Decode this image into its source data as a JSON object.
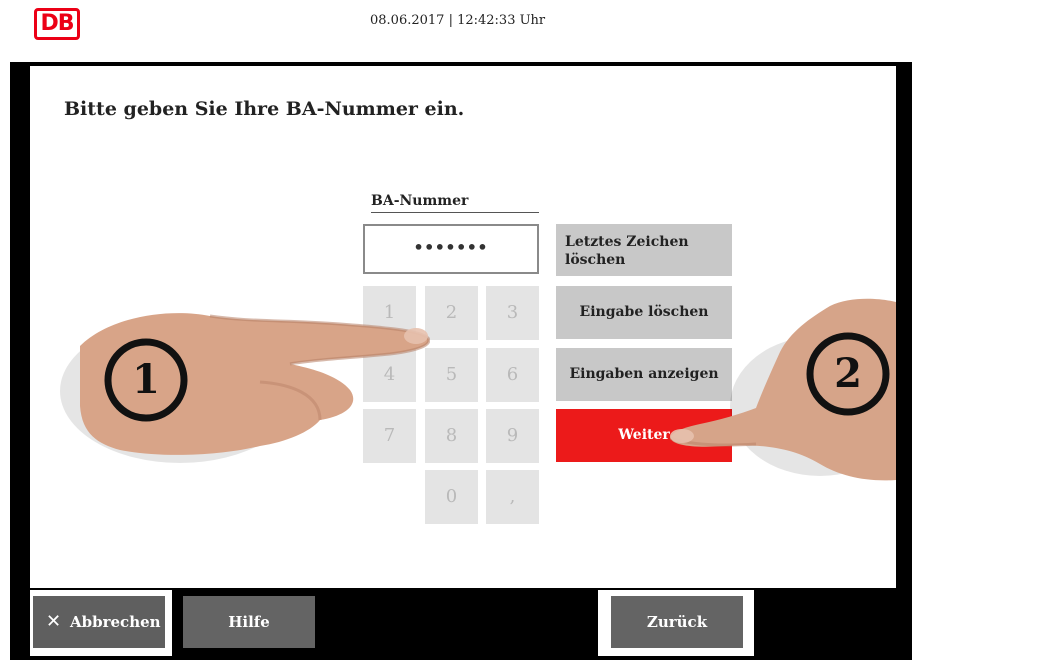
{
  "header": {
    "logo_text": "DB",
    "datetime": "08.06.2017 | 12:42:33 Uhr"
  },
  "main": {
    "prompt": "Bitte geben Sie Ihre BA-Nummer ein.",
    "field_label": "BA-Nummer",
    "input_value": "•••••••",
    "keypad": [
      "1",
      "2",
      "3",
      "4",
      "5",
      "6",
      "7",
      "8",
      "9",
      "0",
      ","
    ],
    "actions": {
      "delete_last": "Letztes Zeichen löschen",
      "clear": "Eingabe löschen",
      "show": "Eingaben anzeigen",
      "next": "Weiter"
    },
    "hand_markers": [
      "1",
      "2"
    ]
  },
  "footer": {
    "cancel_icon": "close-icon",
    "cancel": "Abbrechen",
    "help": "Hilfe",
    "back": "Zurück"
  },
  "colors": {
    "brand_red": "#ec0016",
    "next_button": "#ec1a1a",
    "bottom_button": "#646464",
    "action_button": "#c8c8c8",
    "keypad_key": "#e4e4e4"
  }
}
